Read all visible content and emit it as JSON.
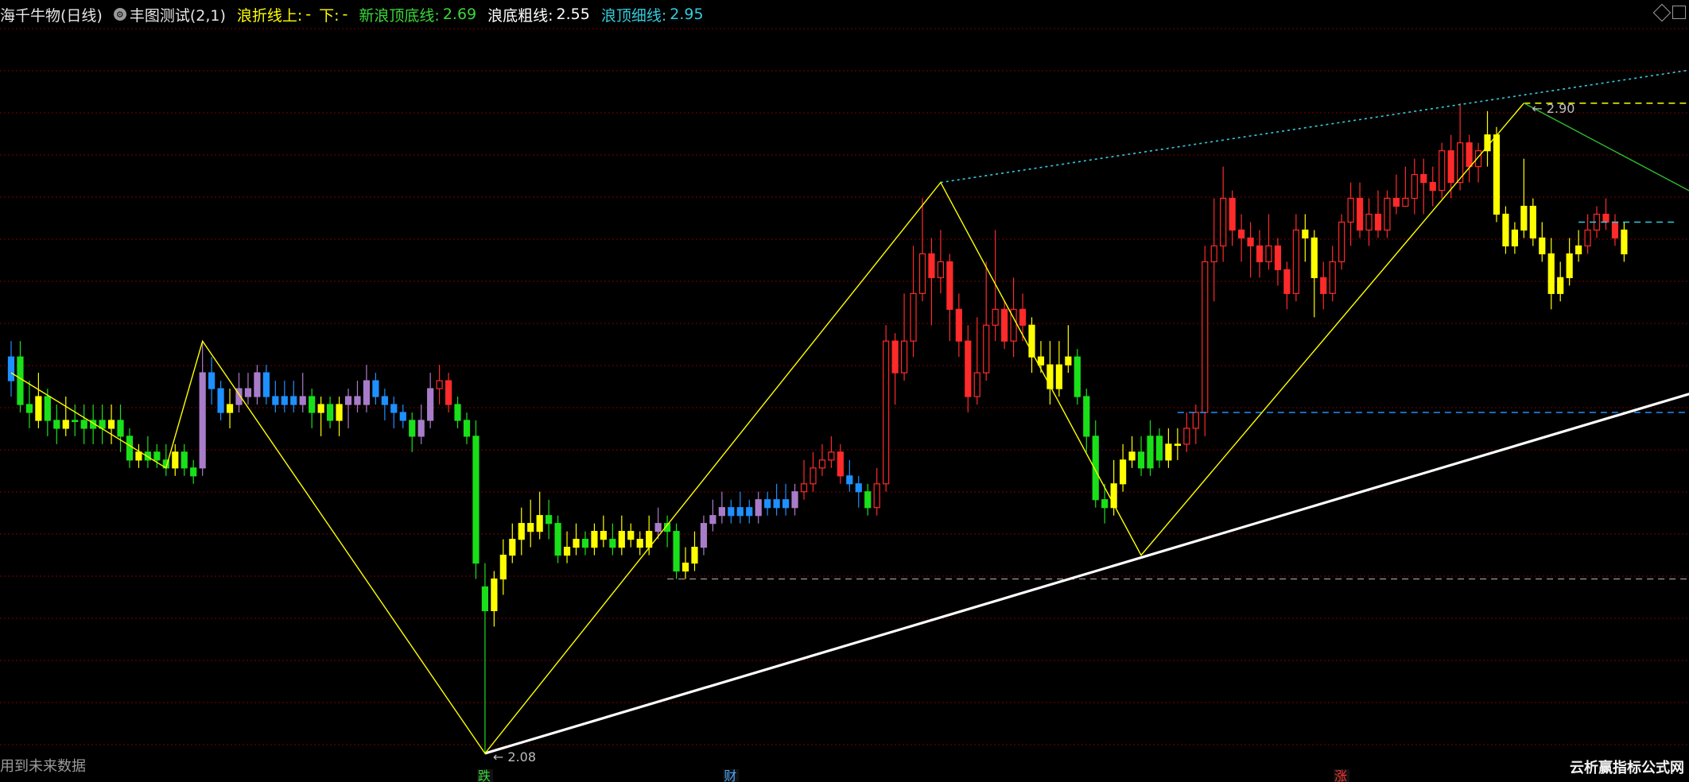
{
  "header": {
    "stock_name": "海千牛物(日线)",
    "gear_icon": "gear-icon",
    "indicator_title": "丰图测试(2,1)",
    "items": [
      {
        "label": "浪折线上:",
        "value": "-",
        "color": "#ffff00"
      },
      {
        "label": "下:",
        "value": "-",
        "color": "#ffff00"
      },
      {
        "label": "新浪顶底线:",
        "value": "2.69",
        "color": "#39d839"
      },
      {
        "label": "浪底粗线:",
        "value": "2.55",
        "color": "#ffffff"
      },
      {
        "label": "浪顶细线:",
        "value": "2.95",
        "color": "#33ccdd"
      }
    ]
  },
  "footer_note": "用到未来数据",
  "brand": "云析赢指标公式网",
  "markers": [
    {
      "text": "跌",
      "color": "#39d839"
    },
    {
      "text": "财",
      "color": "#4aa8ff"
    },
    {
      "text": "涨",
      "color": "#ff3333"
    }
  ],
  "colors": {
    "up": "#ff2a2a",
    "down": "#19e019",
    "blue": "#1e90ff",
    "purple": "#a97cc9",
    "yellow": "#ffff00",
    "cyan": "#33ccdd",
    "grid": "#7a0000"
  },
  "chart_data": {
    "type": "candlestick",
    "y_range": [
      2.06,
      2.98
    ],
    "annotations": [
      {
        "text": "2.90",
        "bar": 166,
        "price": 2.9
      },
      {
        "text": "2.08",
        "bar": 52,
        "price": 2.08
      }
    ],
    "zigzag": [
      {
        "bar": 0,
        "price": 2.56
      },
      {
        "bar": 17,
        "price": 2.44
      },
      {
        "bar": 21,
        "price": 2.6
      },
      {
        "bar": 52,
        "price": 2.08
      },
      {
        "bar": 102,
        "price": 2.8
      },
      {
        "bar": 124,
        "price": 2.33
      },
      {
        "bar": 166,
        "price": 2.9
      },
      {
        "bar": 189,
        "price": 2.76
      }
    ],
    "bottom_line": [
      {
        "bar": 52,
        "price": 2.08
      },
      {
        "bar": 189,
        "price": 2.55
      }
    ],
    "top_line": [
      {
        "bar": 102,
        "price": 2.8
      },
      {
        "bar": 189,
        "price": 2.95
      }
    ],
    "dashed_levels": [
      {
        "price": 2.9,
        "from_bar": 166,
        "to_bar": 189,
        "color": "#ffff00"
      },
      {
        "price": 2.75,
        "from_bar": 172,
        "to_bar": 183,
        "color": "#33ccdd"
      },
      {
        "price": 2.51,
        "from_bar": 128,
        "to_bar": 189,
        "color": "#1e90ff"
      },
      {
        "price": 2.3,
        "from_bar": 72,
        "to_bar": 189,
        "color": "#8a8a8a"
      }
    ],
    "candles": [
      [
        2.55,
        2.58,
        2.6,
        2.53,
        "b"
      ],
      [
        2.58,
        2.52,
        2.6,
        2.51,
        "g"
      ],
      [
        2.52,
        2.51,
        2.55,
        2.49,
        "g"
      ],
      [
        2.5,
        2.53,
        2.56,
        2.49,
        "y"
      ],
      [
        2.53,
        2.5,
        2.54,
        2.48,
        "g"
      ],
      [
        2.5,
        2.49,
        2.52,
        2.47,
        "g"
      ],
      [
        2.49,
        2.5,
        2.53,
        2.48,
        "y"
      ],
      [
        2.5,
        2.5,
        2.52,
        2.48,
        "g"
      ],
      [
        2.5,
        2.49,
        2.52,
        2.47,
        "g"
      ],
      [
        2.49,
        2.5,
        2.52,
        2.47,
        "g"
      ],
      [
        2.5,
        2.49,
        2.52,
        2.47,
        "g"
      ],
      [
        2.49,
        2.5,
        2.52,
        2.47,
        "y"
      ],
      [
        2.5,
        2.48,
        2.52,
        2.46,
        "g"
      ],
      [
        2.48,
        2.45,
        2.49,
        2.44,
        "g"
      ],
      [
        2.45,
        2.46,
        2.47,
        2.44,
        "y"
      ],
      [
        2.46,
        2.45,
        2.48,
        2.44,
        "g"
      ],
      [
        2.45,
        2.46,
        2.47,
        2.44,
        "g"
      ],
      [
        2.45,
        2.44,
        2.47,
        2.43,
        "g"
      ],
      [
        2.44,
        2.46,
        2.47,
        2.43,
        "y"
      ],
      [
        2.46,
        2.44,
        2.47,
        2.43,
        "g"
      ],
      [
        2.44,
        2.43,
        2.45,
        2.42,
        "g"
      ],
      [
        2.44,
        2.56,
        2.6,
        2.43,
        "p"
      ],
      [
        2.56,
        2.54,
        2.58,
        2.52,
        "b"
      ],
      [
        2.54,
        2.51,
        2.55,
        2.5,
        "b"
      ],
      [
        2.51,
        2.52,
        2.54,
        2.49,
        "y"
      ],
      [
        2.52,
        2.54,
        2.56,
        2.51,
        "p"
      ],
      [
        2.54,
        2.53,
        2.56,
        2.52,
        "p"
      ],
      [
        2.53,
        2.56,
        2.57,
        2.52,
        "p"
      ],
      [
        2.56,
        2.53,
        2.57,
        2.52,
        "b"
      ],
      [
        2.53,
        2.52,
        2.55,
        2.51,
        "b"
      ],
      [
        2.52,
        2.53,
        2.55,
        2.51,
        "b"
      ],
      [
        2.53,
        2.52,
        2.55,
        2.51,
        "b"
      ],
      [
        2.52,
        2.53,
        2.56,
        2.51,
        "p"
      ],
      [
        2.53,
        2.51,
        2.54,
        2.49,
        "g"
      ],
      [
        2.51,
        2.52,
        2.53,
        2.48,
        "y"
      ],
      [
        2.52,
        2.5,
        2.53,
        2.49,
        "g"
      ],
      [
        2.5,
        2.52,
        2.53,
        2.48,
        "y"
      ],
      [
        2.52,
        2.53,
        2.54,
        2.49,
        "p"
      ],
      [
        2.53,
        2.52,
        2.55,
        2.51,
        "p"
      ],
      [
        2.52,
        2.55,
        2.57,
        2.51,
        "p"
      ],
      [
        2.55,
        2.53,
        2.56,
        2.52,
        "b"
      ],
      [
        2.53,
        2.52,
        2.54,
        2.5,
        "b"
      ],
      [
        2.52,
        2.51,
        2.53,
        2.49,
        "b"
      ],
      [
        2.51,
        2.5,
        2.52,
        2.49,
        "b"
      ],
      [
        2.5,
        2.48,
        2.51,
        2.46,
        "g"
      ],
      [
        2.48,
        2.5,
        2.52,
        2.47,
        "p"
      ],
      [
        2.5,
        2.54,
        2.56,
        2.49,
        "p"
      ],
      [
        2.54,
        2.55,
        2.57,
        2.52,
        "r"
      ],
      [
        2.55,
        2.52,
        2.56,
        2.51,
        "r"
      ],
      [
        2.52,
        2.5,
        2.53,
        2.49,
        "g"
      ],
      [
        2.5,
        2.48,
        2.51,
        2.47,
        "g"
      ],
      [
        2.48,
        2.32,
        2.5,
        2.3,
        "g"
      ],
      [
        2.29,
        2.26,
        2.32,
        2.08,
        "g"
      ],
      [
        2.26,
        2.3,
        2.31,
        2.24,
        "y"
      ],
      [
        2.3,
        2.33,
        2.35,
        2.28,
        "y"
      ],
      [
        2.33,
        2.35,
        2.37,
        2.32,
        "y"
      ],
      [
        2.35,
        2.37,
        2.39,
        2.33,
        "y"
      ],
      [
        2.37,
        2.36,
        2.4,
        2.34,
        "y"
      ],
      [
        2.36,
        2.38,
        2.41,
        2.35,
        "y"
      ],
      [
        2.38,
        2.37,
        2.4,
        2.35,
        "g"
      ],
      [
        2.37,
        2.33,
        2.38,
        2.32,
        "g"
      ],
      [
        2.33,
        2.34,
        2.36,
        2.32,
        "y"
      ],
      [
        2.34,
        2.35,
        2.37,
        2.33,
        "y"
      ],
      [
        2.35,
        2.34,
        2.36,
        2.33,
        "g"
      ],
      [
        2.34,
        2.36,
        2.37,
        2.33,
        "y"
      ],
      [
        2.36,
        2.35,
        2.38,
        2.34,
        "y"
      ],
      [
        2.35,
        2.34,
        2.37,
        2.33,
        "g"
      ],
      [
        2.34,
        2.36,
        2.38,
        2.33,
        "y"
      ],
      [
        2.36,
        2.35,
        2.37,
        2.34,
        "y"
      ],
      [
        2.35,
        2.34,
        2.36,
        2.33,
        "y"
      ],
      [
        2.34,
        2.36,
        2.38,
        2.33,
        "y"
      ],
      [
        2.36,
        2.37,
        2.39,
        2.35,
        "p"
      ],
      [
        2.37,
        2.36,
        2.38,
        2.34,
        "g"
      ],
      [
        2.36,
        2.31,
        2.37,
        2.3,
        "g"
      ],
      [
        2.31,
        2.32,
        2.34,
        2.3,
        "y"
      ],
      [
        2.32,
        2.34,
        2.36,
        2.31,
        "y"
      ],
      [
        2.34,
        2.37,
        2.38,
        2.33,
        "p"
      ],
      [
        2.37,
        2.38,
        2.4,
        2.36,
        "p"
      ],
      [
        2.38,
        2.39,
        2.41,
        2.37,
        "p"
      ],
      [
        2.39,
        2.38,
        2.4,
        2.37,
        "b"
      ],
      [
        2.38,
        2.39,
        2.41,
        2.37,
        "b"
      ],
      [
        2.39,
        2.38,
        2.4,
        2.37,
        "b"
      ],
      [
        2.38,
        2.4,
        2.41,
        2.37,
        "p"
      ],
      [
        2.4,
        2.39,
        2.41,
        2.38,
        "b"
      ],
      [
        2.39,
        2.4,
        2.42,
        2.38,
        "b"
      ],
      [
        2.4,
        2.39,
        2.42,
        2.38,
        "b"
      ],
      [
        2.39,
        2.41,
        2.42,
        2.38,
        "p"
      ],
      [
        2.41,
        2.42,
        2.45,
        2.4,
        "r"
      ],
      [
        2.42,
        2.44,
        2.46,
        2.41,
        "r"
      ],
      [
        2.44,
        2.45,
        2.47,
        2.43,
        "r"
      ],
      [
        2.45,
        2.46,
        2.48,
        2.44,
        "r"
      ],
      [
        2.46,
        2.43,
        2.47,
        2.42,
        "r"
      ],
      [
        2.43,
        2.42,
        2.45,
        2.41,
        "b"
      ],
      [
        2.42,
        2.41,
        2.43,
        2.39,
        "b"
      ],
      [
        2.41,
        2.39,
        2.42,
        2.38,
        "g"
      ],
      [
        2.39,
        2.42,
        2.44,
        2.38,
        "r"
      ],
      [
        2.42,
        2.6,
        2.62,
        2.41,
        "r"
      ],
      [
        2.6,
        2.56,
        2.61,
        2.52,
        "r"
      ],
      [
        2.56,
        2.6,
        2.66,
        2.55,
        "r"
      ],
      [
        2.6,
        2.66,
        2.72,
        2.58,
        "r"
      ],
      [
        2.66,
        2.71,
        2.78,
        2.65,
        "r"
      ],
      [
        2.71,
        2.68,
        2.73,
        2.62,
        "r"
      ],
      [
        2.68,
        2.7,
        2.74,
        2.66,
        "r"
      ],
      [
        2.7,
        2.64,
        2.71,
        2.6,
        "r"
      ],
      [
        2.64,
        2.6,
        2.66,
        2.58,
        "r"
      ],
      [
        2.6,
        2.53,
        2.62,
        2.51,
        "r"
      ],
      [
        2.53,
        2.56,
        2.63,
        2.52,
        "r"
      ],
      [
        2.56,
        2.62,
        2.7,
        2.55,
        "r"
      ],
      [
        2.62,
        2.64,
        2.74,
        2.6,
        "r"
      ],
      [
        2.64,
        2.6,
        2.65,
        2.59,
        "r"
      ],
      [
        2.6,
        2.64,
        2.68,
        2.58,
        "r"
      ],
      [
        2.64,
        2.62,
        2.66,
        2.6,
        "r"
      ],
      [
        2.62,
        2.58,
        2.63,
        2.56,
        "y"
      ],
      [
        2.58,
        2.57,
        2.6,
        2.56,
        "y"
      ],
      [
        2.57,
        2.54,
        2.6,
        2.52,
        "y"
      ],
      [
        2.54,
        2.57,
        2.6,
        2.53,
        "y"
      ],
      [
        2.57,
        2.58,
        2.62,
        2.56,
        "y"
      ],
      [
        2.58,
        2.53,
        2.59,
        2.52,
        "g"
      ],
      [
        2.53,
        2.48,
        2.54,
        2.46,
        "g"
      ],
      [
        2.48,
        2.4,
        2.5,
        2.39,
        "g"
      ],
      [
        2.4,
        2.39,
        2.42,
        2.37,
        "g"
      ],
      [
        2.39,
        2.42,
        2.45,
        2.38,
        "y"
      ],
      [
        2.42,
        2.45,
        2.47,
        2.41,
        "y"
      ],
      [
        2.45,
        2.46,
        2.48,
        2.44,
        "y"
      ],
      [
        2.46,
        2.44,
        2.48,
        2.43,
        "g"
      ],
      [
        2.44,
        2.48,
        2.5,
        2.43,
        "g"
      ],
      [
        2.48,
        2.45,
        2.49,
        2.44,
        "g"
      ],
      [
        2.45,
        2.47,
        2.49,
        2.44,
        "y"
      ],
      [
        2.47,
        2.47,
        2.49,
        2.45,
        "y"
      ],
      [
        2.47,
        2.49,
        2.51,
        2.46,
        "r"
      ],
      [
        2.49,
        2.51,
        2.52,
        2.47,
        "r"
      ],
      [
        2.51,
        2.7,
        2.72,
        2.48,
        "r"
      ],
      [
        2.7,
        2.72,
        2.78,
        2.65,
        "r"
      ],
      [
        2.72,
        2.78,
        2.82,
        2.7,
        "r"
      ],
      [
        2.78,
        2.74,
        2.79,
        2.72,
        "r"
      ],
      [
        2.74,
        2.73,
        2.76,
        2.7,
        "r"
      ],
      [
        2.73,
        2.72,
        2.75,
        2.68,
        "r"
      ],
      [
        2.72,
        2.7,
        2.74,
        2.68,
        "r"
      ],
      [
        2.7,
        2.72,
        2.76,
        2.69,
        "r"
      ],
      [
        2.72,
        2.69,
        2.73,
        2.67,
        "r"
      ],
      [
        2.69,
        2.66,
        2.7,
        2.64,
        "r"
      ],
      [
        2.66,
        2.74,
        2.76,
        2.65,
        "r"
      ],
      [
        2.74,
        2.73,
        2.76,
        2.7,
        "y"
      ],
      [
        2.73,
        2.68,
        2.74,
        2.63,
        "y"
      ],
      [
        2.68,
        2.66,
        2.7,
        2.64,
        "r"
      ],
      [
        2.66,
        2.7,
        2.72,
        2.65,
        "r"
      ],
      [
        2.7,
        2.75,
        2.76,
        2.69,
        "r"
      ],
      [
        2.75,
        2.78,
        2.8,
        2.72,
        "r"
      ],
      [
        2.78,
        2.74,
        2.8,
        2.73,
        "r"
      ],
      [
        2.74,
        2.76,
        2.78,
        2.72,
        "r"
      ],
      [
        2.76,
        2.74,
        2.79,
        2.73,
        "r"
      ],
      [
        2.74,
        2.78,
        2.79,
        2.73,
        "r"
      ],
      [
        2.78,
        2.77,
        2.81,
        2.76,
        "r"
      ],
      [
        2.77,
        2.78,
        2.82,
        2.77,
        "r"
      ],
      [
        2.78,
        2.81,
        2.83,
        2.76,
        "r"
      ],
      [
        2.81,
        2.8,
        2.83,
        2.76,
        "r"
      ],
      [
        2.8,
        2.79,
        2.82,
        2.77,
        "r"
      ],
      [
        2.79,
        2.84,
        2.85,
        2.78,
        "r"
      ],
      [
        2.84,
        2.8,
        2.86,
        2.78,
        "r"
      ],
      [
        2.8,
        2.85,
        2.9,
        2.79,
        "r"
      ],
      [
        2.85,
        2.82,
        2.86,
        2.8,
        "r"
      ],
      [
        2.82,
        2.84,
        2.85,
        2.8,
        "r"
      ],
      [
        2.84,
        2.86,
        2.89,
        2.82,
        "y"
      ],
      [
        2.86,
        2.76,
        2.87,
        2.75,
        "y"
      ],
      [
        2.76,
        2.72,
        2.77,
        2.71,
        "y"
      ],
      [
        2.72,
        2.74,
        2.75,
        2.71,
        "y"
      ],
      [
        2.74,
        2.77,
        2.83,
        2.73,
        "y"
      ],
      [
        2.77,
        2.73,
        2.78,
        2.72,
        "y"
      ],
      [
        2.73,
        2.71,
        2.75,
        2.7,
        "y"
      ],
      [
        2.71,
        2.66,
        2.73,
        2.64,
        "y"
      ],
      [
        2.66,
        2.68,
        2.7,
        2.65,
        "y"
      ],
      [
        2.68,
        2.71,
        2.73,
        2.67,
        "y"
      ],
      [
        2.71,
        2.72,
        2.74,
        2.7,
        "y"
      ],
      [
        2.72,
        2.74,
        2.76,
        2.71,
        "r"
      ],
      [
        2.74,
        2.76,
        2.77,
        2.73,
        "r"
      ],
      [
        2.76,
        2.75,
        2.78,
        2.74,
        "r"
      ],
      [
        2.75,
        2.73,
        2.76,
        2.72,
        "r"
      ],
      [
        2.74,
        2.71,
        2.75,
        2.7,
        "y"
      ]
    ]
  }
}
